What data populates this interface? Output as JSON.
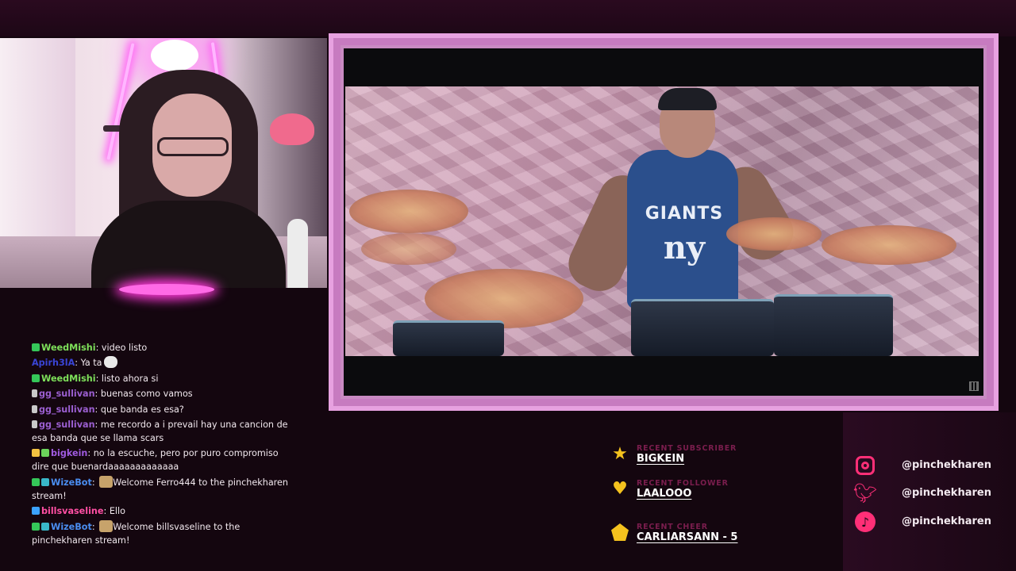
{
  "chat": {
    "messages": [
      {
        "badges": [
          "check"
        ],
        "user": "WeedMishi",
        "color": "#7ee05a",
        "text": "video listo",
        "emote": ""
      },
      {
        "badges": [],
        "user": "Apirh3lA",
        "color": "#3a45d6",
        "text": "Ya ta",
        "emote": "face-emote"
      },
      {
        "badges": [
          "check"
        ],
        "user": "WeedMishi",
        "color": "#7ee05a",
        "text": "listo ahora si",
        "emote": ""
      },
      {
        "badges": [
          "sub"
        ],
        "user": "gg_sullivan",
        "color": "#9b5fd1",
        "text": "buenas como vamos",
        "emote": ""
      },
      {
        "badges": [
          "sub"
        ],
        "user": "gg_sullivan",
        "color": "#9b5fd1",
        "text": "que banda es esa?",
        "emote": ""
      },
      {
        "badges": [
          "sub"
        ],
        "user": "gg_sullivan",
        "color": "#9b5fd1",
        "text": "me recordo a i prevail hay una cancion de esa banda que se llama scars",
        "emote": ""
      },
      {
        "badges": [
          "crown",
          "lime"
        ],
        "user": "bigkein",
        "color": "#a05be0",
        "text": "no la escuche, pero por puro compromiso dire que buenardaaaaaaaaaaaaa",
        "emote": ""
      },
      {
        "badges": [
          "check",
          "bot"
        ],
        "user": "WizeBot",
        "color": "#4a8df0",
        "text": "Welcome Ferro444 to the pinchekharen stream!",
        "emote": "cat-emote"
      },
      {
        "badges": [
          "prime"
        ],
        "user": "billsvaseline",
        "color": "#ff4fa3",
        "text": "Ello",
        "emote": ""
      },
      {
        "badges": [
          "check",
          "bot"
        ],
        "user": "WizeBot",
        "color": "#4a8df0",
        "text": "Welcome billsvaseline to the pinchekharen stream!",
        "emote": "cat-emote"
      }
    ]
  },
  "recent": {
    "subscriber": {
      "label": "RECENT SUBSCRIBER",
      "value": "BIGKEIN",
      "icon": "star-icon"
    },
    "follower": {
      "label": "RECENT FOLLOWER",
      "value": "LAALOOO",
      "icon": "heart-icon"
    },
    "cheer": {
      "label": "RECENT CHEER",
      "value": "CARLIARSANN - 5",
      "icon": "bits-icon"
    }
  },
  "socials": [
    {
      "network": "instagram",
      "icon": "instagram-icon",
      "handle": "@pinchekharen"
    },
    {
      "network": "twitter",
      "icon": "twitter-icon",
      "handle": "@pinchekharen"
    },
    {
      "network": "tiktok",
      "icon": "tiktok-icon",
      "handle": "@pinchekharen"
    }
  ],
  "video": {
    "jersey_top": "GIANTS",
    "jersey_bottom": "ny"
  },
  "colors": {
    "frame": "#e7a1e0",
    "accent": "#ff2f77",
    "star": "#f4c21e"
  }
}
